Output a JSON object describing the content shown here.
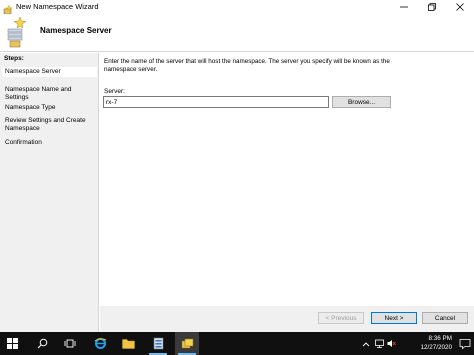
{
  "window": {
    "title": "New Namespace Wizard",
    "header_title": "Namespace Server"
  },
  "sidebar": {
    "steps_label": "Steps:",
    "items": [
      {
        "label": "Namespace Server",
        "active": true
      },
      {
        "label": "Namespace Name and Settings",
        "active": false
      },
      {
        "label": "Namespace Type",
        "active": false
      },
      {
        "label": "Review Settings and Create Namespace",
        "active": false
      },
      {
        "label": "Confirmation",
        "active": false
      }
    ]
  },
  "main": {
    "description": "Enter the name of the server that will host the namespace. The server you specify will be known as the namespace server.",
    "server_label": "Server:",
    "server_value": "rx-7",
    "browse_label": "Browse..."
  },
  "footer": {
    "previous_label": "< Previous",
    "next_label": "Next >",
    "cancel_label": "Cancel"
  },
  "taskbar": {
    "time": "8:36 PM",
    "date": "12/27/2020",
    "accent": "#76b9ed"
  }
}
